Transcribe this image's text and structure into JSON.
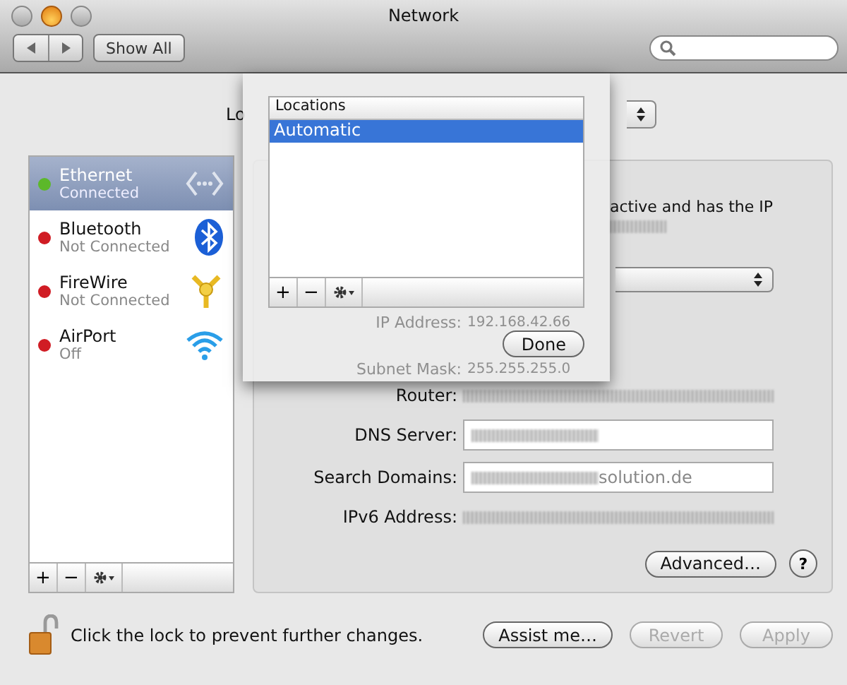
{
  "window": {
    "title": "Network"
  },
  "toolbar": {
    "show_all": "Show All"
  },
  "location": {
    "label": "Lo"
  },
  "services": [
    {
      "name": "Ethernet",
      "status": "Connected",
      "color": "#5cb82a",
      "selected": true,
      "kind": "ethernet"
    },
    {
      "name": "Bluetooth",
      "status": "Not Connected",
      "color": "#d01c24",
      "selected": false,
      "kind": "bluetooth"
    },
    {
      "name": "FireWire",
      "status": "Not Connected",
      "color": "#d01c24",
      "selected": false,
      "kind": "firewire"
    },
    {
      "name": "AirPort",
      "status": "Off",
      "color": "#d01c24",
      "selected": false,
      "kind": "wifi"
    }
  ],
  "service_actions": [
    "+",
    "−"
  ],
  "detail": {
    "status_text": "active and has the IP",
    "rows": [
      {
        "kind": "text",
        "label": "IP Address:",
        "value": "192.168.42.66",
        "faded": true
      },
      {
        "kind": "text",
        "label": "Subnet Mask:",
        "value": "255.255.255.0",
        "faded": true
      },
      {
        "kind": "text",
        "label": "Router:",
        "blurred": true
      },
      {
        "kind": "field",
        "label": "DNS Server:",
        "blurred": true
      },
      {
        "kind": "field",
        "label": "Search Domains:",
        "value": "solution.de",
        "blurred": true
      },
      {
        "kind": "text",
        "label": "IPv6 Address:",
        "blurred": true
      }
    ],
    "advanced": "Advanced…",
    "help": "?"
  },
  "footer": {
    "lock_text": "Click the lock to prevent further changes.",
    "buttons": [
      {
        "label": "Assist me…",
        "disabled": false
      },
      {
        "label": "Revert",
        "disabled": true
      },
      {
        "label": "Apply",
        "disabled": true
      }
    ]
  },
  "sheet": {
    "list_header": "Locations",
    "locations": [
      {
        "name": "Automatic",
        "selected": true
      }
    ],
    "actions": [
      "+",
      "−"
    ],
    "done": "Done"
  }
}
